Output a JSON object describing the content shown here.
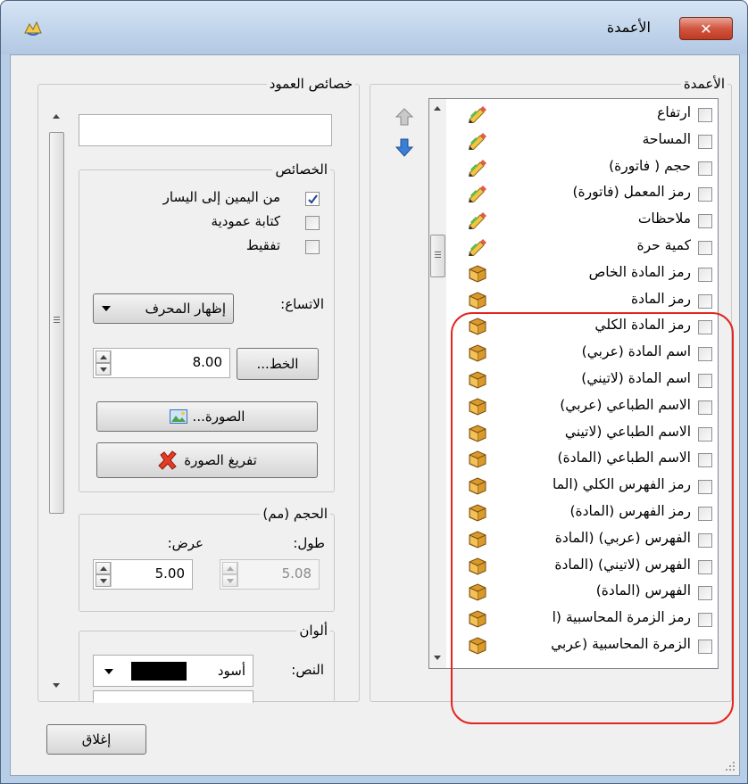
{
  "window": {
    "title": "الأعمدة",
    "close_symbol": "✕"
  },
  "columns_group": {
    "title": "الأعمدة",
    "items": [
      {
        "label": "ارتفاع",
        "icon": "pencil-icon"
      },
      {
        "label": "المساحة",
        "icon": "pencil-icon"
      },
      {
        "label": "حجم ( فاتورة)",
        "icon": "pencil-icon"
      },
      {
        "label": "رمز المعمل (فاتورة)",
        "icon": "pencil-icon"
      },
      {
        "label": "ملاحظات",
        "icon": "pencil-icon"
      },
      {
        "label": "كمية حرة",
        "icon": "pencil-icon"
      },
      {
        "label": "رمز المادة الخاص",
        "icon": "box-icon"
      },
      {
        "label": "رمز المادة",
        "icon": "box-icon"
      },
      {
        "label": "رمز المادة الكلي",
        "icon": "box-icon"
      },
      {
        "label": "اسم المادة (عربي)",
        "icon": "box-icon"
      },
      {
        "label": "اسم المادة (لاتيني)",
        "icon": "box-icon"
      },
      {
        "label": "الاسم الطباعي (عربي)",
        "icon": "box-icon"
      },
      {
        "label": "الاسم الطباعي (لاتيني",
        "icon": "box-icon"
      },
      {
        "label": "الاسم الطباعي (المادة)",
        "icon": "box-icon"
      },
      {
        "label": "رمز الفهرس الكلي (الما",
        "icon": "box-icon"
      },
      {
        "label": "رمز الفهرس (المادة)",
        "icon": "box-icon"
      },
      {
        "label": "الفهرس (عربي) (المادة",
        "icon": "box-icon"
      },
      {
        "label": "الفهرس (لاتيني) (المادة",
        "icon": "box-icon"
      },
      {
        "label": "الفهرس (المادة)",
        "icon": "box-icon"
      },
      {
        "label": "رمز الزمرة المحاسبية (ا",
        "icon": "box-icon"
      },
      {
        "label": "الزمرة المحاسبية (عربي",
        "icon": "box-icon"
      }
    ]
  },
  "column_props": {
    "title": "خصائص العمود",
    "name_value": "",
    "properties": {
      "title": "الخصائص",
      "rtl_label": "من اليمين إلى اليسار",
      "rtl_checked": true,
      "vertical_label": "كتابة عمودية",
      "vertical_checked": false,
      "dotted_label": "تفقيط",
      "dotted_checked": false,
      "overflow_label": "الاتساع:",
      "overflow_value": "إظهار المحرف",
      "font_button": "الخط...",
      "font_size": "8.00",
      "image_button": "الصورة...",
      "clear_image_button": "تفريغ الصورة"
    },
    "size": {
      "title": "الحجم (مم)",
      "length_label": "طول:",
      "length_value": "5.08",
      "width_label": "عرض:",
      "width_value": "5.00"
    },
    "colors": {
      "title": "ألوان",
      "text_label": "النص:",
      "text_color_name": "أسود",
      "text_color_hex": "#000000"
    }
  },
  "footer": {
    "close_button": "إغلاق"
  },
  "theme": {
    "highlight": "#e2261f"
  }
}
